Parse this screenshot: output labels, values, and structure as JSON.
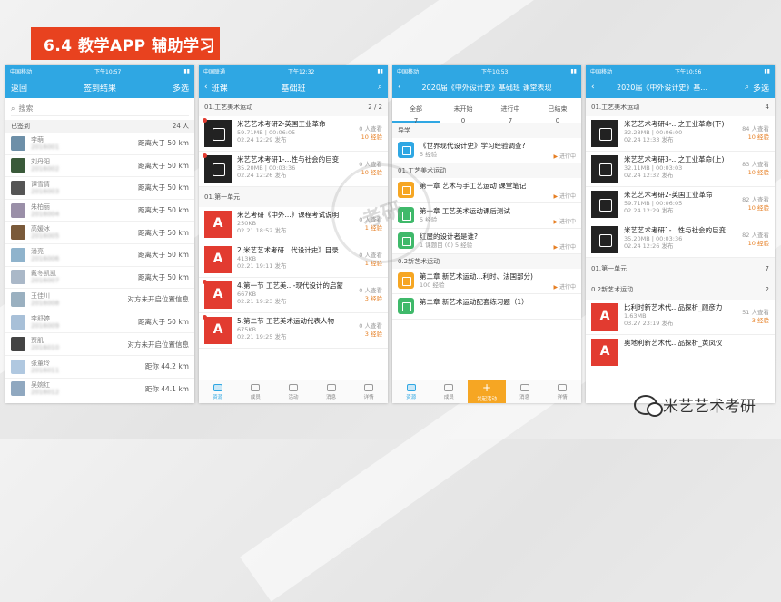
{
  "banner": {
    "title": "6.4 教学APP 辅助学习"
  },
  "watermark": {
    "text": "考研"
  },
  "logo": {
    "text": "米艺艺术考研"
  },
  "phone1": {
    "status": {
      "carrier": "中国移动",
      "time": "下午10:57"
    },
    "nav": {
      "left": "返回",
      "title": "签到结果",
      "right": "多选"
    },
    "search_placeholder": "搜索",
    "section": {
      "label": "已签到",
      "count": "24 人"
    },
    "rows": [
      {
        "name": "李萌",
        "sub": "2016001",
        "dist": "距离大于 50 km",
        "color": "#6d8fa8"
      },
      {
        "name": "刘丹阳",
        "sub": "2016002",
        "dist": "距离大于 50 km",
        "color": "#3a5a3a"
      },
      {
        "name": "谭雪倩",
        "sub": "2016003",
        "dist": "距离大于 50 km",
        "color": "#555555"
      },
      {
        "name": "朱柏丽",
        "sub": "2016004",
        "dist": "距离大于 50 km",
        "color": "#9a8fa8"
      },
      {
        "name": "高媛冰",
        "sub": "2016005",
        "dist": "距离大于 50 km",
        "color": "#7a5a3a"
      },
      {
        "name": "潘亮",
        "sub": "2016006",
        "dist": "距离大于 50 km",
        "color": "#8fb3cc"
      },
      {
        "name": "戴冬凯凯",
        "sub": "2016007",
        "dist": "距离大于 50 km",
        "color": "#aab8c8"
      },
      {
        "name": "王佳川",
        "sub": "2016008",
        "dist": "对方未开启位置信息",
        "color": "#9ab0c0"
      },
      {
        "name": "李舒婷",
        "sub": "2016009",
        "dist": "距离大于 50 km",
        "color": "#a8c0d8"
      },
      {
        "name": "贾肌",
        "sub": "2016010",
        "dist": "对方未开启位置信息",
        "color": "#444444"
      },
      {
        "name": "张董玲",
        "sub": "2016011",
        "dist": "距你 44.2 km",
        "color": "#b0c8e0"
      },
      {
        "name": "吴婉红",
        "sub": "2016012",
        "dist": "距你 44.1 km",
        "color": "#90a8c0"
      }
    ]
  },
  "phone2": {
    "status": {
      "carrier": "中国联通",
      "time": "下午12:32"
    },
    "nav": {
      "left": "班课",
      "title": "基础班"
    },
    "sec1": {
      "label": "01.工艺美术运动",
      "count": "2 / 2"
    },
    "videos": [
      {
        "title": "米艺艺术考研2-英国工业革命",
        "size": "59.71MB",
        "dur": "00:06:05",
        "date": "02.24 12:29 发布",
        "views": "0 人查看",
        "exp": "10 经验"
      },
      {
        "title": "米艺艺术考研1-...性与社会的巨变",
        "size": "35.20MB",
        "dur": "00:03:36",
        "date": "02.24 12:26 发布",
        "views": "0 人查看",
        "exp": "10 经验"
      }
    ],
    "sec2": {
      "label": "01.第一单元"
    },
    "pdfs": [
      {
        "title": "米艺考研《中外...》课程考试说明",
        "size": "250KB",
        "date": "02.21 18:52 发布",
        "views": "0 人查看",
        "exp": "1 经验"
      },
      {
        "title": "2.米艺艺术考研...代设计史》目录",
        "size": "413KB",
        "date": "02.21 19:11 发布",
        "views": "0 人查看",
        "exp": "1 经验"
      },
      {
        "title": "4.第一节 工艺美...-现代设计的启蒙",
        "size": "667KB",
        "date": "02.21 19:23 发布",
        "views": "0 人查看",
        "exp": "3 经验"
      },
      {
        "title": "5.第二节 工艺美术运动代表人物",
        "size": "675KB",
        "date": "02.21 19:25 发布",
        "views": "0 人查看",
        "exp": "3 经验"
      }
    ],
    "tabs": [
      "资源",
      "成员",
      "活动",
      "消息",
      "详情"
    ]
  },
  "phone3": {
    "status": {
      "carrier": "中国移动",
      "time": "下午10:53"
    },
    "nav": {
      "title": "2020届《中外设计史》基础班 课堂表现"
    },
    "stabs": [
      {
        "label": "全部",
        "count": "7"
      },
      {
        "label": "未开始",
        "count": "0"
      },
      {
        "label": "进行中",
        "count": "7"
      },
      {
        "label": "已结束",
        "count": "0"
      }
    ],
    "sec1": {
      "label": "导学"
    },
    "guide": {
      "title": "《世界现代设计史》学习经验调查?",
      "meta": "5 经验",
      "status": "进行中"
    },
    "sec2": {
      "label": "01.工艺美术运动"
    },
    "acts1": [
      {
        "title": "第一章 艺术与手工艺运动 课堂笔记",
        "meta": "",
        "status": "进行中"
      },
      {
        "title": "第一章 工艺美术运动课后测试",
        "meta": "5 经验",
        "status": "进行中"
      },
      {
        "title": "红屋的设计者是谁?",
        "meta": "1 课题目 (0)  5 经验",
        "status": "进行中"
      }
    ],
    "sec3": {
      "label": "0.2新艺术运动"
    },
    "acts2": [
      {
        "title": "第二章 新艺术运动...利时、法国部分)",
        "meta": "100 经验",
        "status": "进行中"
      },
      {
        "title": "第二章 新艺术运动配套练习题（1）",
        "meta": "",
        "status": ""
      }
    ],
    "tabs": [
      "资源",
      "成员",
      "发起活动",
      "消息",
      "详情"
    ]
  },
  "phone4": {
    "status": {
      "carrier": "中国移动",
      "time": "下午10:56"
    },
    "nav": {
      "title": "2020届《中外设计史》基...",
      "right": "多选"
    },
    "sec1": {
      "label": "01.工艺美术运动",
      "count": "4"
    },
    "videos": [
      {
        "title": "米艺艺术考研4-...之工业革命(下)",
        "size": "32.28MB",
        "dur": "00:06:00",
        "date": "02.24 12:33 发布",
        "views": "84 人查看",
        "exp": "10 经验"
      },
      {
        "title": "米艺艺术考研3-...之工业革命(上)",
        "size": "32.11MB",
        "dur": "00:03:03",
        "date": "02.24 12:32 发布",
        "views": "83 人查看",
        "exp": "10 经验"
      },
      {
        "title": "米艺艺术考研2-英国工业革命",
        "size": "59.71MB",
        "dur": "00:06:05",
        "date": "02.24 12:29 发布",
        "views": "82 人查看",
        "exp": "10 经验"
      },
      {
        "title": "米艺艺术考研1-...性与社会的巨变",
        "size": "35.20MB",
        "dur": "00:03:36",
        "date": "02.24 12:26 发布",
        "views": "82 人查看",
        "exp": "10 经验"
      }
    ],
    "sec2": {
      "label": "01.第一单元",
      "count": "7"
    },
    "sec3": {
      "label": "0.2新艺术运动",
      "count": "2"
    },
    "pdfs": [
      {
        "title": "比利时新艺术代...品探析_顾彦力",
        "size": "1.63MB",
        "date": "03.27 23:19 发布",
        "views": "51 人查看",
        "exp": "3 经验"
      },
      {
        "title": "奥地利新艺术代...品探析_黄凤仪",
        "size": "",
        "date": "",
        "views": "",
        "exp": ""
      }
    ]
  }
}
